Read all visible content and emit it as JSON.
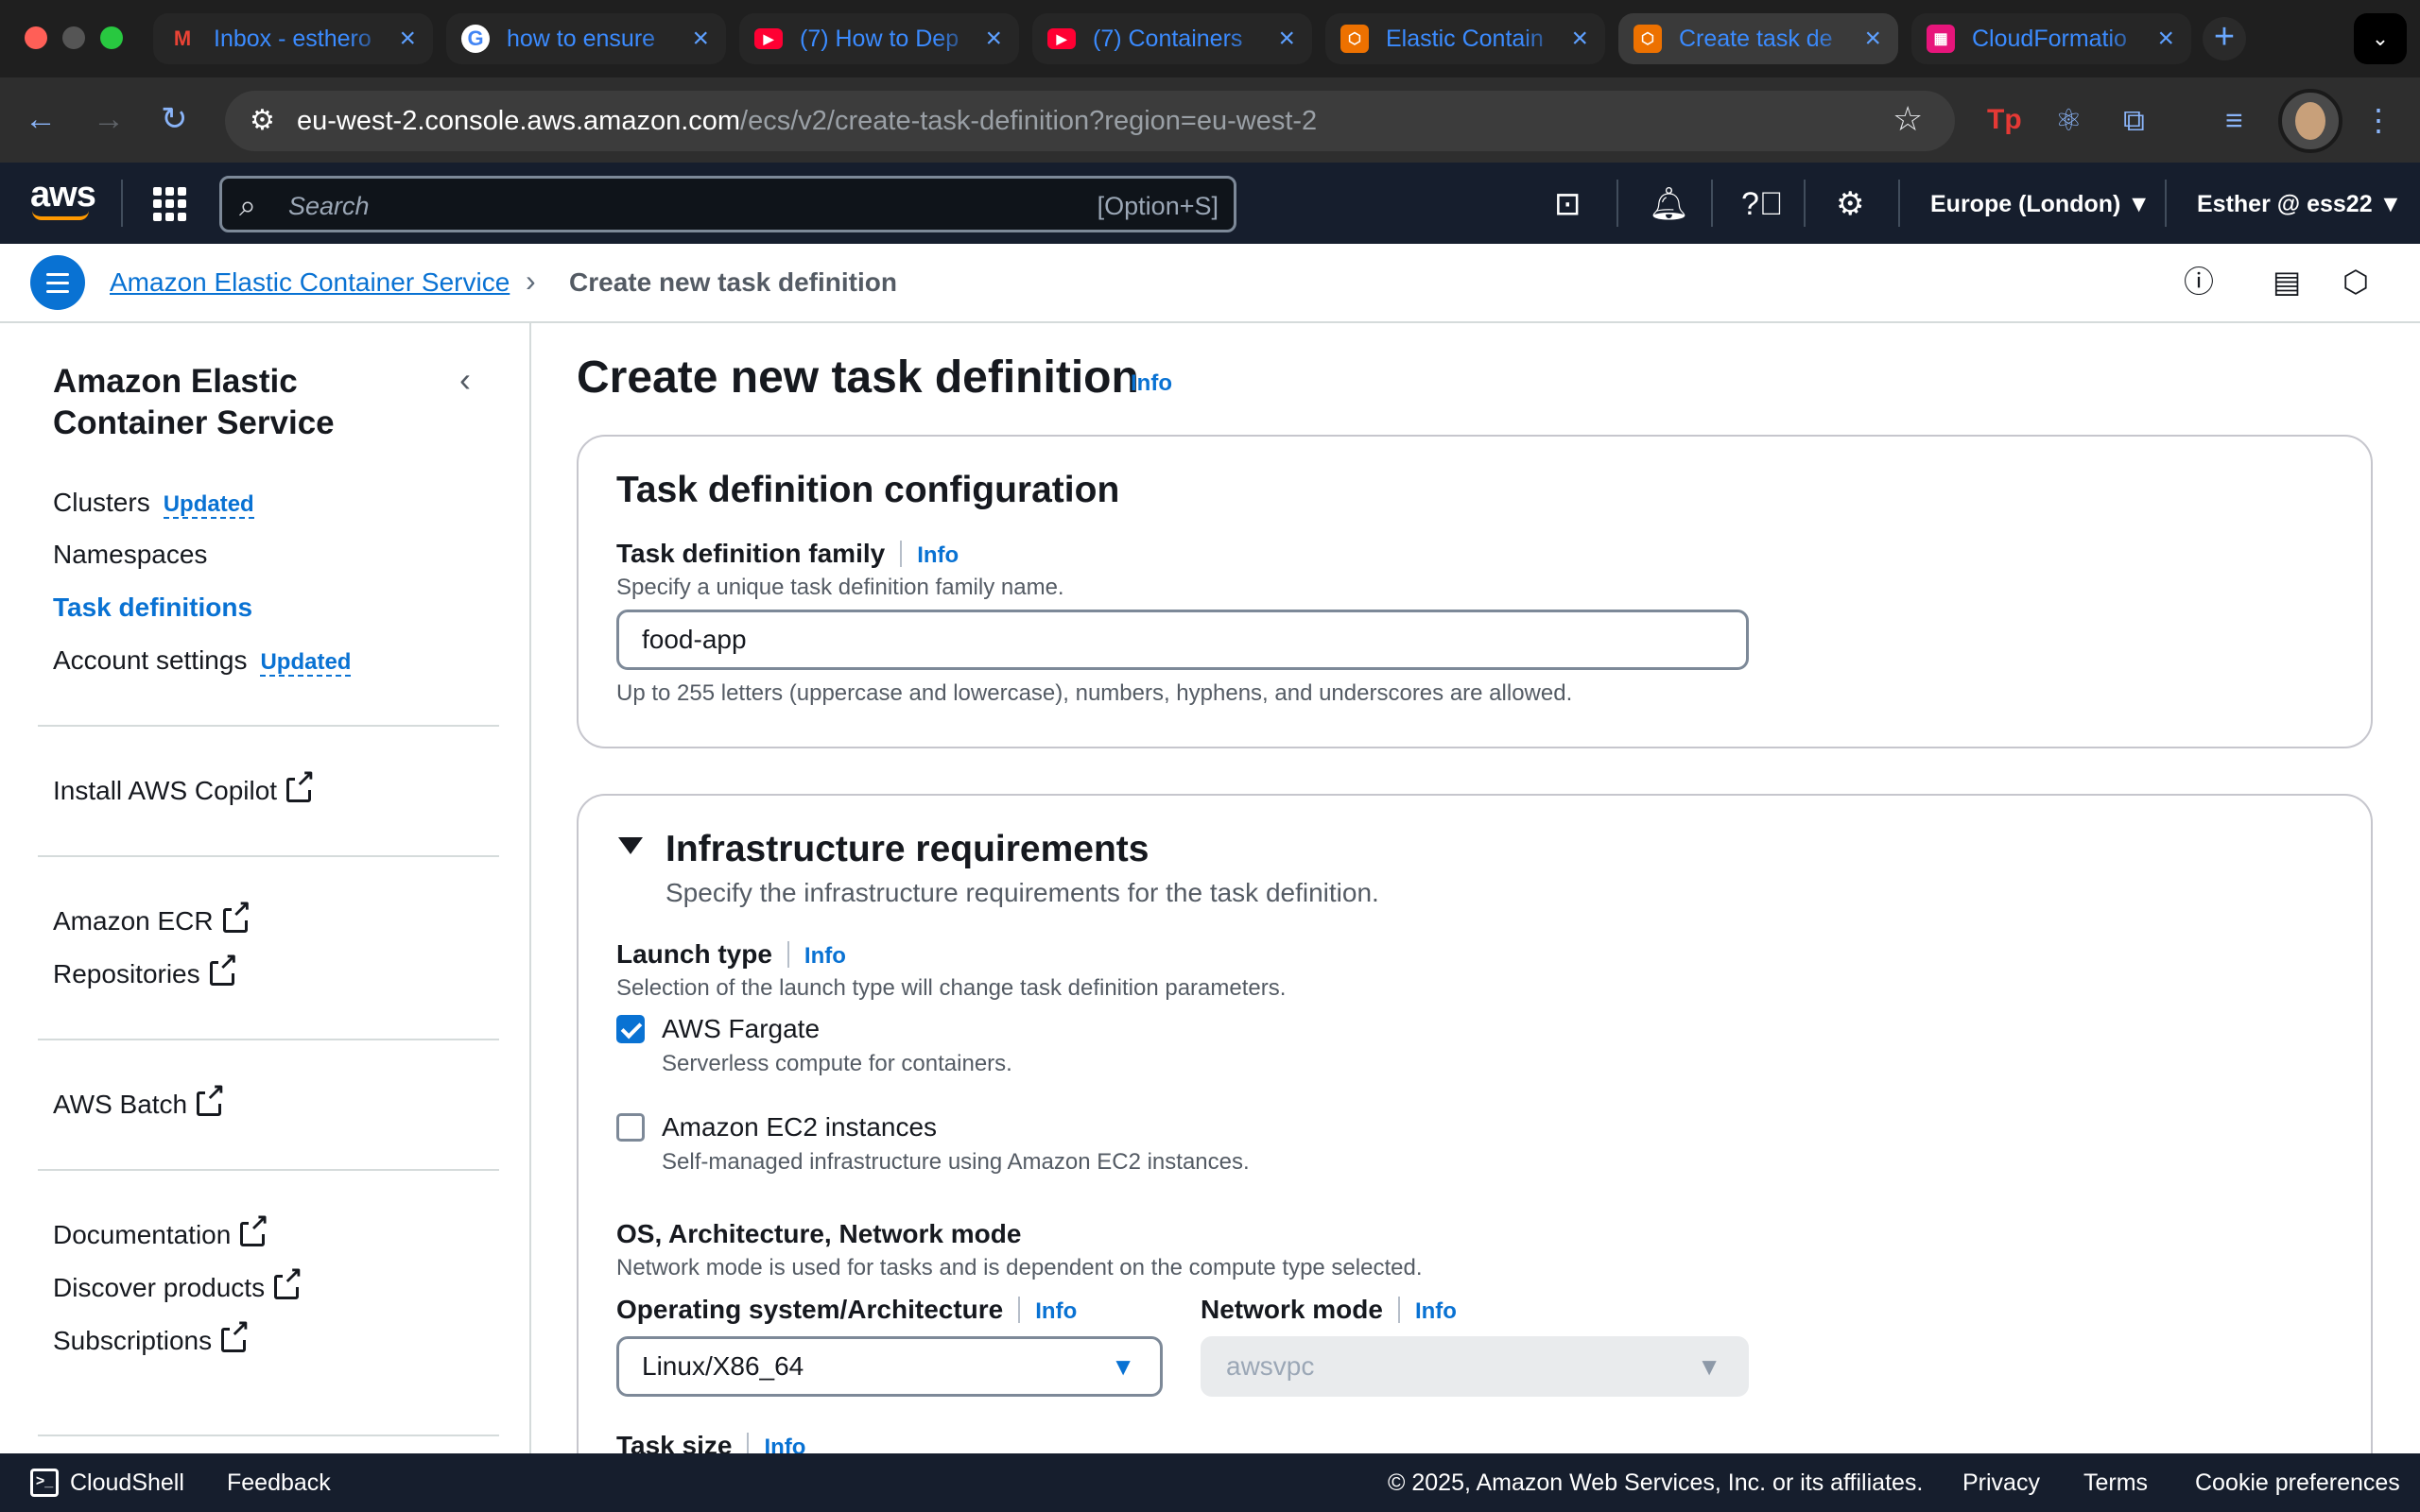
{
  "browser": {
    "tabs": [
      {
        "title": "Inbox - esthero",
        "icon": "gmail-icon"
      },
      {
        "title": "how to ensure",
        "icon": "google-icon"
      },
      {
        "title": "(7) How to Dep",
        "icon": "youtube-icon"
      },
      {
        "title": "(7) Containers",
        "icon": "youtube-icon"
      },
      {
        "title": "Elastic Contain",
        "icon": "ecs-icon"
      },
      {
        "title": "Create task de",
        "icon": "ecs-icon"
      },
      {
        "title": "CloudFormatio",
        "icon": "cloudformation-icon"
      }
    ],
    "url_host": "eu-west-2.console.aws.amazon.com",
    "url_path": "/ecs/v2/create-task-definition?region=eu-west-2"
  },
  "aws_nav": {
    "logo": "aws",
    "search_placeholder": "Search",
    "search_shortcut": "[Option+S]",
    "region": "Europe (London) ▼",
    "account": "Esther @ ess22 ▼"
  },
  "breadcrumb": {
    "parent": "Amazon Elastic Container Service",
    "current": "Create new task definition"
  },
  "sidebar": {
    "title": "Amazon Elastic Container Service",
    "items": [
      {
        "label": "Clusters",
        "badge": "Updated"
      },
      {
        "label": "Namespaces"
      },
      {
        "label": "Task definitions"
      },
      {
        "label": "Account settings",
        "badge": "Updated"
      }
    ],
    "links1": [
      "Install AWS Copilot"
    ],
    "links2": [
      "Amazon ECR",
      "Repositories"
    ],
    "links3": [
      "AWS Batch"
    ],
    "links4": [
      "Documentation",
      "Discover products",
      "Subscriptions"
    ]
  },
  "page": {
    "title": "Create new task definition",
    "info": "Info"
  },
  "config_panel": {
    "title": "Task definition configuration",
    "family_label": "Task definition family",
    "family_info": "Info",
    "family_desc": "Specify a unique task definition family name.",
    "family_value": "food-app",
    "family_hint": "Up to 255 letters (uppercase and lowercase), numbers, hyphens, and underscores are allowed."
  },
  "infra_panel": {
    "title": "Infrastructure requirements",
    "desc": "Specify the infrastructure requirements for the task definition.",
    "launch_label": "Launch type",
    "launch_info": "Info",
    "launch_desc": "Selection of the launch type will change task definition parameters.",
    "fargate_label": "AWS Fargate",
    "fargate_desc": "Serverless compute for containers.",
    "ec2_label": "Amazon EC2 instances",
    "ec2_desc": "Self-managed infrastructure using Amazon EC2 instances.",
    "os_section": "OS, Architecture, Network mode",
    "os_section_desc": "Network mode is used for tasks and is dependent on the compute type selected.",
    "os_label": "Operating system/Architecture",
    "os_info": "Info",
    "os_value": "Linux/X86_64",
    "net_label": "Network mode",
    "net_info": "Info",
    "net_value": "awsvpc",
    "task_size_label": "Task size",
    "task_size_info": "Info"
  },
  "footer": {
    "cloudshell": "CloudShell",
    "feedback": "Feedback",
    "copyright": "© 2025, Amazon Web Services, Inc. or its affiliates.",
    "privacy": "Privacy",
    "terms": "Terms",
    "cookies": "Cookie preferences"
  }
}
